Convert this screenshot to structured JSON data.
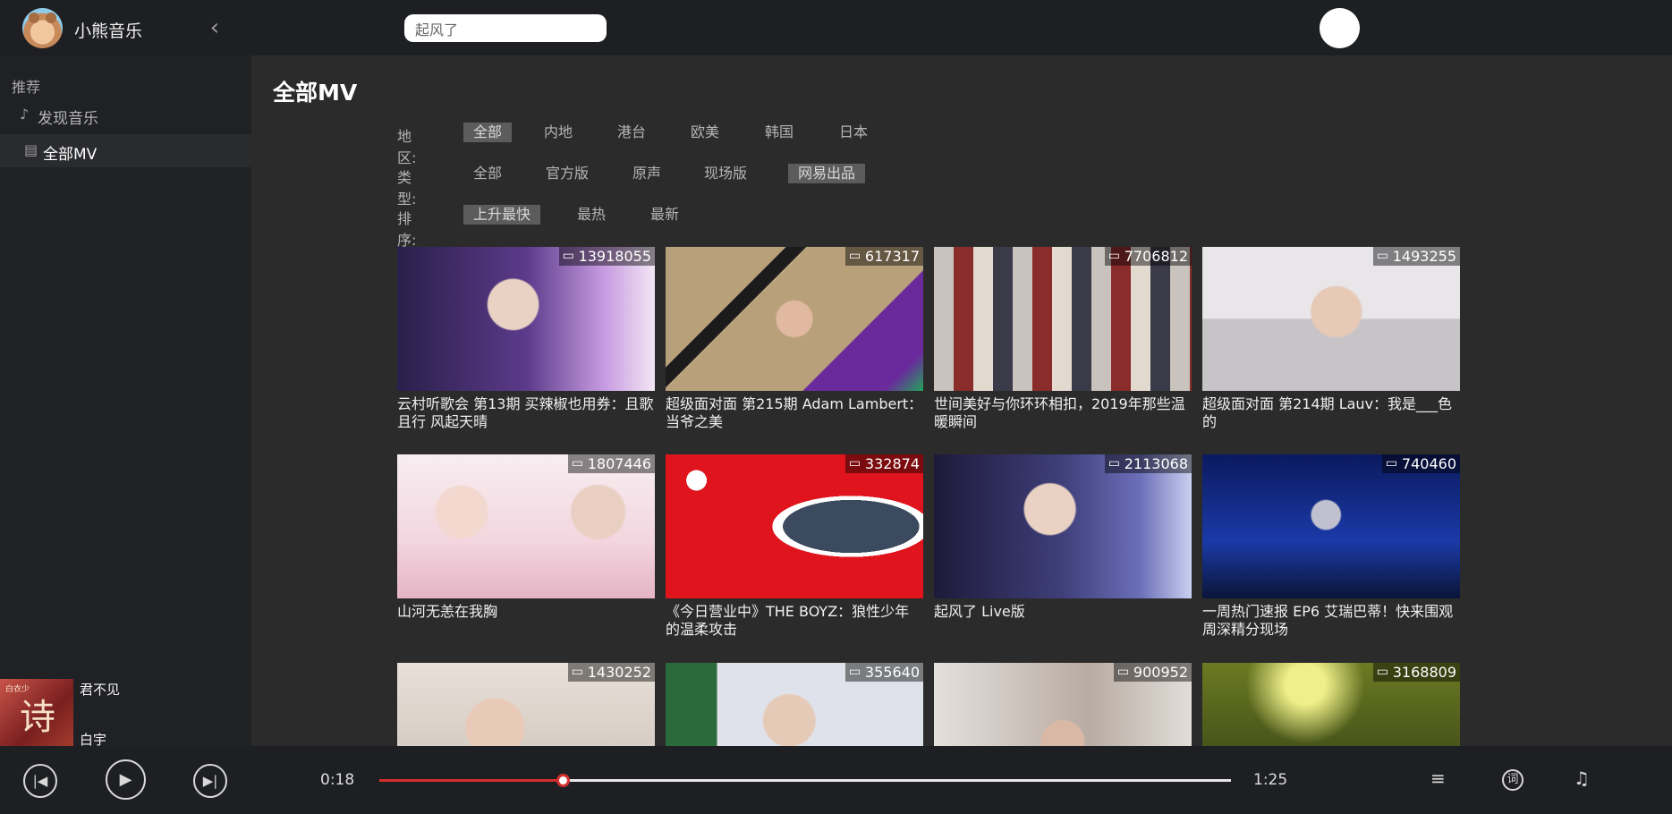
{
  "header": {
    "app_name": "小熊音乐",
    "back_icon": "chevron-left-icon",
    "search_value": "起风了"
  },
  "sidebar": {
    "heading": "推荐",
    "items": [
      {
        "label": "发现音乐",
        "icon": "music-note-icon",
        "active": false
      },
      {
        "label": "全部MV",
        "icon": "document-icon",
        "active": true
      }
    ]
  },
  "now_playing": {
    "title": "君不见",
    "artist": "白宇",
    "cover_text": "诗",
    "cover_small": "白衣少"
  },
  "main": {
    "title": "全部MV",
    "filters": [
      {
        "label": "地区:",
        "options": [
          "全部",
          "内地",
          "港台",
          "欧美",
          "韩国",
          "日本"
        ],
        "selected": 0
      },
      {
        "label": "类型:",
        "options": [
          "全部",
          "官方版",
          "原声",
          "现场版",
          "网易出品"
        ],
        "selected": 4
      },
      {
        "label": "排序:",
        "options": [
          "上升最快",
          "最热",
          "最新"
        ],
        "selected": 0
      }
    ],
    "mvs": [
      {
        "count": "13918055",
        "title": "云村听歌会 第13期 买辣椒也用券：且歌且行 风起天晴"
      },
      {
        "count": "617317",
        "title": "超级面对面 第215期 Adam Lambert：当爷之美"
      },
      {
        "count": "7706812",
        "title": "世间美好与你环环相扣，2019年那些温暖瞬间"
      },
      {
        "count": "1493255",
        "title": "超级面对面 第214期 Lauv：我是___色的"
      },
      {
        "count": "1807446",
        "title": "山河无恙在我胸"
      },
      {
        "count": "332874",
        "title": "《今日营业中》THE BOYZ：狼性少年的温柔攻击"
      },
      {
        "count": "2113068",
        "title": "起风了 Live版"
      },
      {
        "count": "740460",
        "title": "一周热门速报 EP6 艾瑞巴蒂！快来围观周深精分现场"
      },
      {
        "count": "1430252",
        "title": ""
      },
      {
        "count": "355640",
        "title": ""
      },
      {
        "count": "900952",
        "title": ""
      },
      {
        "count": "3168809",
        "title": ""
      }
    ]
  },
  "player": {
    "current_time": "0:18",
    "total_time": "1:25",
    "progress": 0.215,
    "controls": [
      "skip-previous-icon",
      "play-icon",
      "skip-next-icon"
    ],
    "right_icons": [
      "playlist-add-icon",
      "lyrics-icon",
      "queue-music-icon"
    ],
    "accent": "#d32f2f"
  }
}
